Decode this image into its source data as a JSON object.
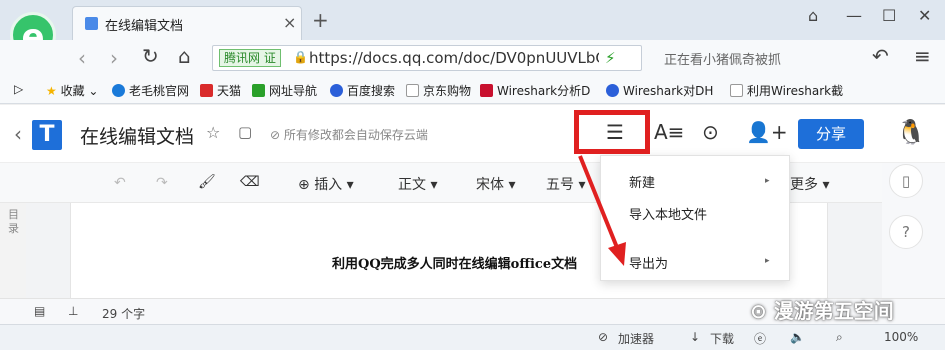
{
  "browser": {
    "tab_title": "在线编辑文档",
    "tab_close": "×",
    "new_tab": "+",
    "window_controls": [
      "⌂",
      "—",
      "☐",
      "✕"
    ],
    "site_badge": "腾讯网 证",
    "url": "https://docs.qq.com/doc/DV0pnUUVLbGxk",
    "search_text": "正在看小猪佩奇被抓",
    "bookmarks": [
      "收藏",
      "老毛桃官网",
      "天猫",
      "网址导航",
      "百度搜索",
      "京东购物",
      "Wireshark分析D",
      "Wireshark对DH",
      "利用Wireshark截"
    ],
    "status": {
      "accelerator": "加速器",
      "download": "下载",
      "zoom": "100%"
    }
  },
  "doc": {
    "logo": "T",
    "title": "在线编辑文档",
    "save_status": "所有修改都会自动保存云端",
    "share_label": "分享",
    "toolbar": {
      "insert": "插入",
      "style": "正文",
      "font": "宋体",
      "size": "五号",
      "more": "更多"
    },
    "toc_label": "目录",
    "body_text": "利用QQ完成多人同时在线编辑office文档",
    "word_count": "29 个字"
  },
  "menu": {
    "items": [
      "新建",
      "导入本地文件",
      "导出为"
    ]
  },
  "watermark": "漫游第五空间",
  "colors": {
    "accent": "#1e6fd9",
    "annotation": "#e02020"
  }
}
